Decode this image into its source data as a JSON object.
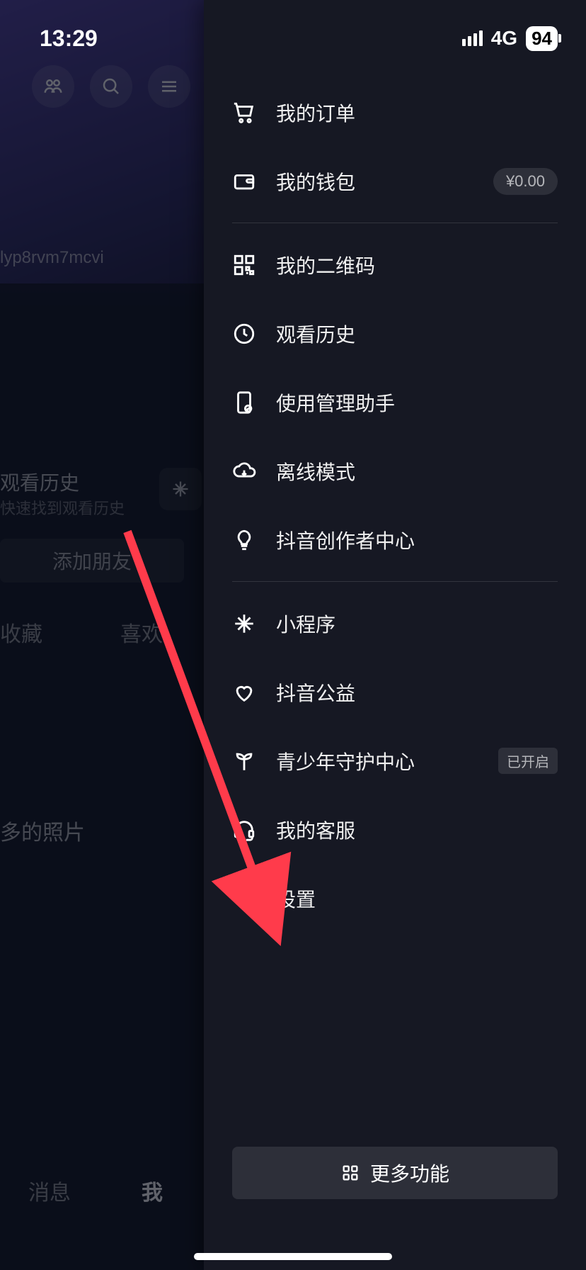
{
  "status_bar": {
    "time": "13:29",
    "network": "4G",
    "battery": "94"
  },
  "background": {
    "username": "lyp8rvm7mcvi",
    "history_title": "观看历史",
    "history_subtitle": "快速找到观看历史",
    "add_friend": "添加朋友",
    "tab_collect": "收藏",
    "tab_like": "喜欢",
    "photos_label": "多的照片",
    "nav_messages": "消息",
    "nav_me": "我"
  },
  "drawer": {
    "items": [
      {
        "icon": "cart",
        "label": "我的订单",
        "badge": null,
        "badge_type": null
      },
      {
        "icon": "wallet",
        "label": "我的钱包",
        "badge": "¥0.00",
        "badge_type": "pill"
      }
    ],
    "items2": [
      {
        "icon": "qrcode",
        "label": "我的二维码",
        "badge": null
      },
      {
        "icon": "clock",
        "label": "观看历史",
        "badge": null
      },
      {
        "icon": "phone-manage",
        "label": "使用管理助手",
        "badge": null
      },
      {
        "icon": "cloud-download",
        "label": "离线模式",
        "badge": null
      },
      {
        "icon": "bulb",
        "label": "抖音创作者中心",
        "badge": null
      }
    ],
    "items3": [
      {
        "icon": "sparkle",
        "label": "小程序",
        "badge": null
      },
      {
        "icon": "heart-ribbon",
        "label": "抖音公益",
        "badge": null
      },
      {
        "icon": "sprout",
        "label": "青少年守护中心",
        "badge": "已开启",
        "badge_type": "text"
      },
      {
        "icon": "headset",
        "label": "我的客服",
        "badge": null
      },
      {
        "icon": "gear",
        "label": "设置",
        "badge": null
      }
    ],
    "more_button": "更多功能"
  },
  "annotation": {
    "arrow_color": "#ff3b4b"
  }
}
